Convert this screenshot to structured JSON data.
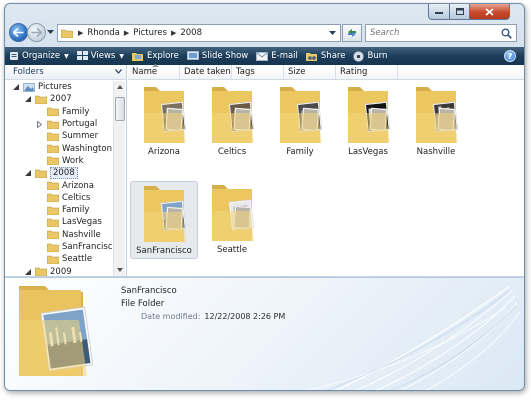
{
  "address": {
    "crumbs": [
      "Rhonda",
      "Pictures",
      "2008"
    ],
    "search_placeholder": "Search"
  },
  "toolbar": {
    "organize": "Organize",
    "views": "Views",
    "explore": "Explore",
    "slideshow": "Slide Show",
    "email": "E-mail",
    "share": "Share",
    "burn": "Burn",
    "help": "?"
  },
  "folders_pane": {
    "header": "Folders",
    "tree": [
      {
        "label": "Pictures",
        "level": 0,
        "expander": "expanded"
      },
      {
        "label": "2007",
        "level": 1,
        "expander": "expanded"
      },
      {
        "label": "Family",
        "level": 2,
        "expander": "none"
      },
      {
        "label": "Portugal",
        "level": 2,
        "expander": "collapsed"
      },
      {
        "label": "Summer",
        "level": 2,
        "expander": "none"
      },
      {
        "label": "Washington",
        "level": 2,
        "expander": "none"
      },
      {
        "label": "Work",
        "level": 2,
        "expander": "none"
      },
      {
        "label": "2008",
        "level": 1,
        "expander": "expanded",
        "selected": true
      },
      {
        "label": "Arizona",
        "level": 2,
        "expander": "none"
      },
      {
        "label": "Celtics",
        "level": 2,
        "expander": "none"
      },
      {
        "label": "Family",
        "level": 2,
        "expander": "none"
      },
      {
        "label": "LasVegas",
        "level": 2,
        "expander": "none"
      },
      {
        "label": "Nashville",
        "level": 2,
        "expander": "none"
      },
      {
        "label": "SanFrancisco",
        "level": 2,
        "expander": "none"
      },
      {
        "label": "Seattle",
        "level": 2,
        "expander": "none"
      },
      {
        "label": "2009",
        "level": 1,
        "expander": "expanded"
      }
    ]
  },
  "columns": [
    "Name",
    "Date taken",
    "Tags",
    "Size",
    "Rating"
  ],
  "files": [
    {
      "name": "Arizona",
      "photo": "arizona",
      "selected": false
    },
    {
      "name": "Celtics",
      "photo": "celtics",
      "selected": false
    },
    {
      "name": "Family",
      "photo": "family",
      "selected": false
    },
    {
      "name": "LasVegas",
      "photo": "lasvegas",
      "selected": false
    },
    {
      "name": "Nashville",
      "photo": "nashville",
      "selected": false
    },
    {
      "name": "SanFrancisco",
      "photo": "sanfrancisco",
      "selected": true
    },
    {
      "name": "Seattle",
      "photo": "seattle",
      "selected": false
    }
  ],
  "details": {
    "name": "SanFrancisco",
    "type": "File Folder",
    "modified_label": "Date modified:",
    "modified_value": "12/22/2008 2:26 PM"
  },
  "colors": {
    "toolbar_bg": "#1d3e5a",
    "folder_yellow": "#f0cf6e",
    "selection": "#e6e9ee"
  }
}
